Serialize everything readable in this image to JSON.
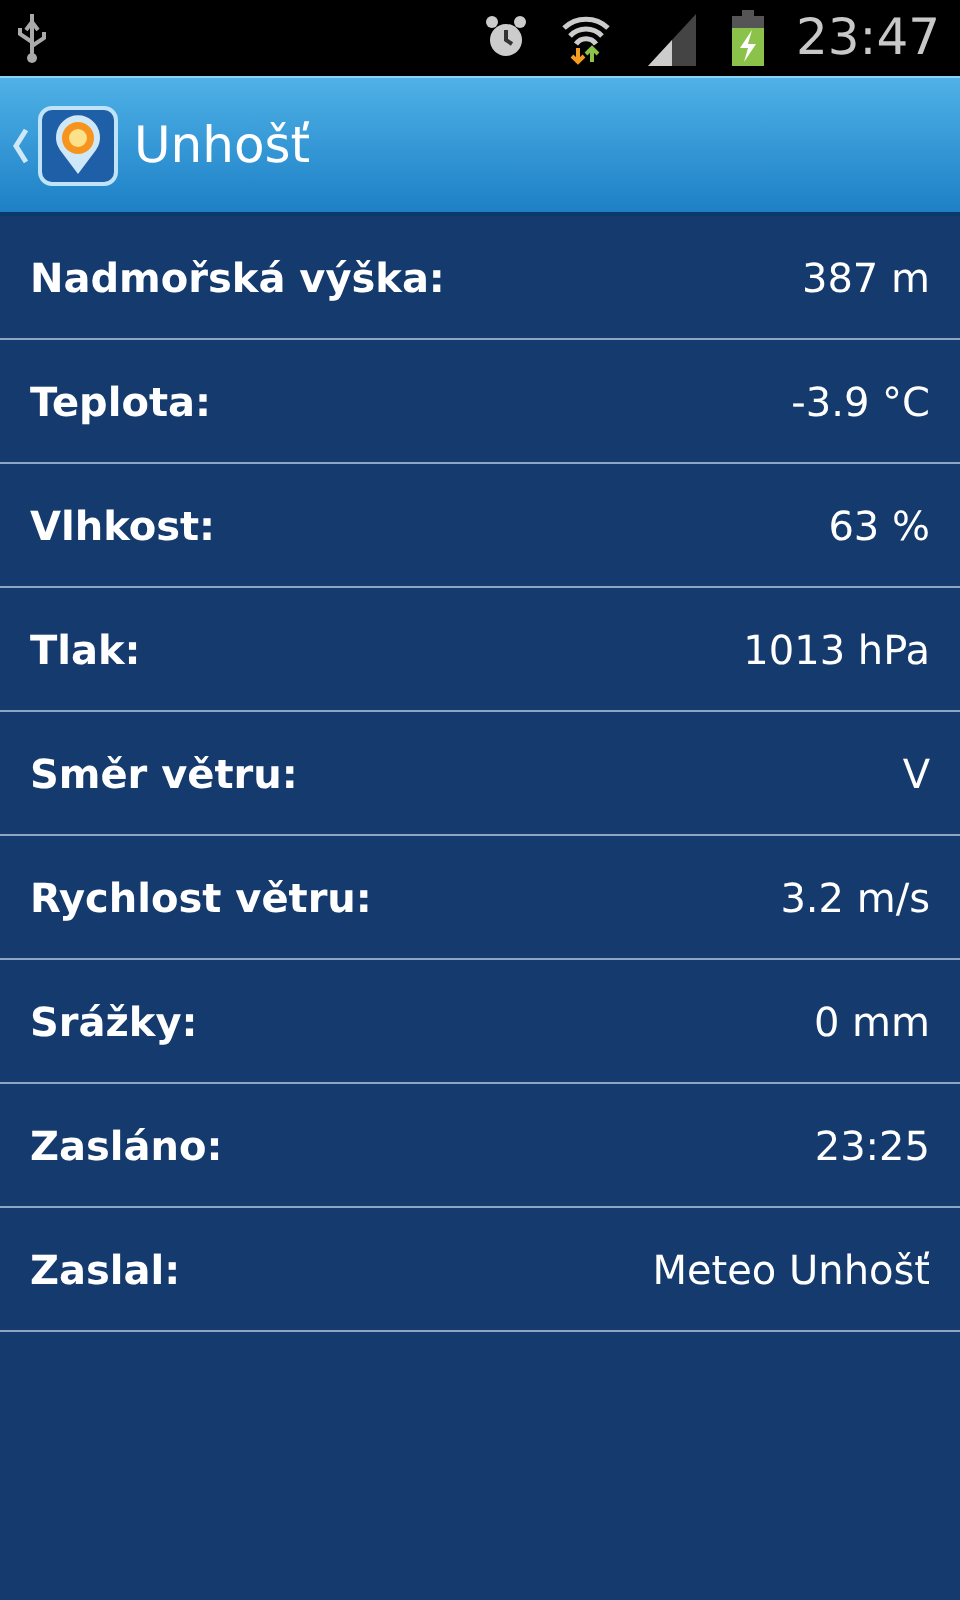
{
  "status_bar": {
    "time": "23:47"
  },
  "action_bar": {
    "title": "Unhošť"
  },
  "rows": [
    {
      "label": "Nadmořská výška:",
      "value": "387 m"
    },
    {
      "label": "Teplota:",
      "value": "-3.9 °C"
    },
    {
      "label": "Vlhkost:",
      "value": "63 %"
    },
    {
      "label": "Tlak:",
      "value": "1013 hPa"
    },
    {
      "label": "Směr větru:",
      "value": "V"
    },
    {
      "label": "Rychlost větru:",
      "value": "3.2 m/s"
    },
    {
      "label": "Srážky:",
      "value": "0 mm"
    },
    {
      "label": "Zasláno:",
      "value": "23:25"
    },
    {
      "label": "Zaslal:",
      "value": "Meteo Unhošť"
    }
  ]
}
